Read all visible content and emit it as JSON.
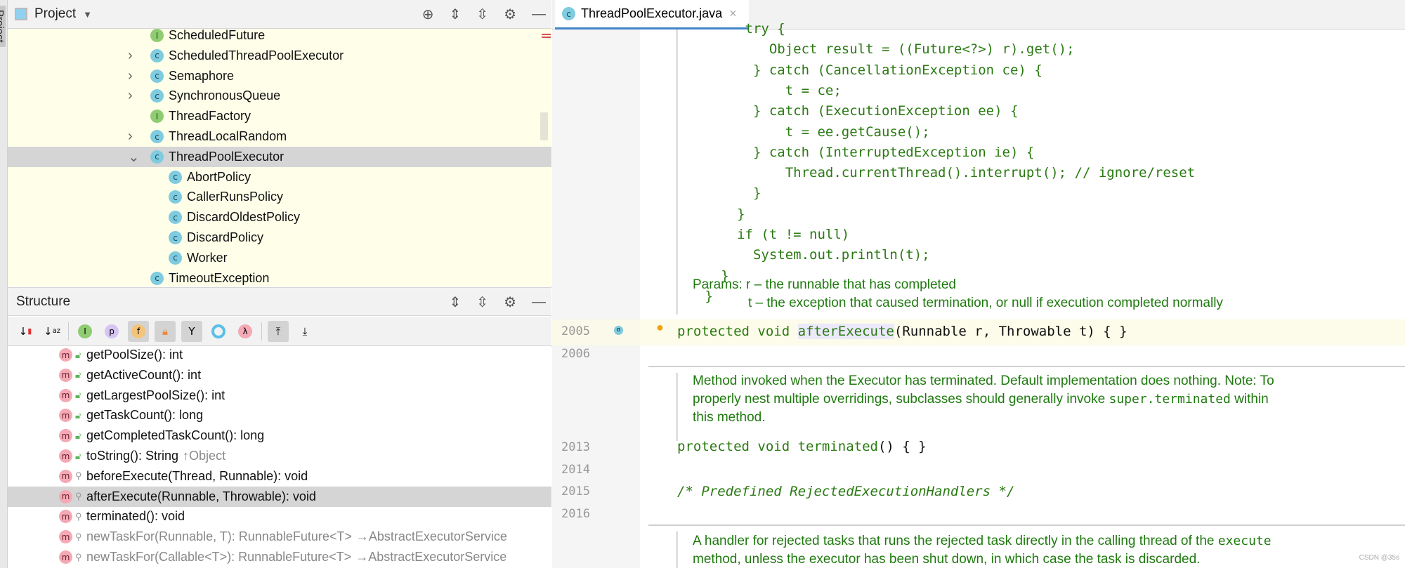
{
  "side_strip": {
    "label": "Project"
  },
  "project_panel": {
    "title": "Project",
    "tools": [
      "locate-icon",
      "expand-all-icon",
      "collapse-all-icon",
      "gear-icon",
      "minimize-icon"
    ],
    "items": [
      {
        "label": "ScheduledFuture",
        "kind": "I",
        "expandable": false,
        "level": 0
      },
      {
        "label": "ScheduledThreadPoolExecutor",
        "kind": "C",
        "expandable": true,
        "level": 0
      },
      {
        "label": "Semaphore",
        "kind": "C",
        "expandable": true,
        "level": 0
      },
      {
        "label": "SynchronousQueue",
        "kind": "C",
        "expandable": true,
        "level": 0
      },
      {
        "label": "ThreadFactory",
        "kind": "I",
        "expandable": false,
        "level": 0
      },
      {
        "label": "ThreadLocalRandom",
        "kind": "C",
        "expandable": true,
        "level": 0
      },
      {
        "label": "ThreadPoolExecutor",
        "kind": "C",
        "expandable": true,
        "expanded": true,
        "selected": true,
        "level": 0
      },
      {
        "label": "AbortPolicy",
        "kind": "C",
        "level": 1
      },
      {
        "label": "CallerRunsPolicy",
        "kind": "C",
        "level": 1
      },
      {
        "label": "DiscardOldestPolicy",
        "kind": "C",
        "level": 1
      },
      {
        "label": "DiscardPolicy",
        "kind": "C",
        "level": 1
      },
      {
        "label": "Worker",
        "kind": "C",
        "level": 1
      },
      {
        "label": "TimeoutException",
        "kind": "C",
        "expandable": false,
        "level": 0
      }
    ]
  },
  "structure_panel": {
    "title": "Structure",
    "toolbar": [
      "sort-by-visibility",
      "sort-alphabetically",
      "show-inherited",
      "show-properties",
      "show-fields",
      "show-non-public",
      "show-anonymous",
      "show-lambdas",
      "show-lambda",
      "autoscroll-to-source",
      "autoscroll-from-source"
    ],
    "items": [
      {
        "label": "getPoolSize(): int",
        "access": "public"
      },
      {
        "label": "getActiveCount(): int",
        "access": "public"
      },
      {
        "label": "getLargestPoolSize(): int",
        "access": "public"
      },
      {
        "label": "getTaskCount(): long",
        "access": "public"
      },
      {
        "label": "getCompletedTaskCount(): long",
        "access": "public"
      },
      {
        "label": "toString(): String",
        "suffix": "↑Object",
        "access": "public"
      },
      {
        "label": "beforeExecute(Thread, Runnable): void",
        "access": "protected"
      },
      {
        "label": "afterExecute(Runnable, Throwable): void",
        "access": "protected",
        "selected": true
      },
      {
        "label": "terminated(): void",
        "access": "protected"
      },
      {
        "label": "newTaskFor(Runnable, T): RunnableFuture<T>",
        "suffix": "→AbstractExecutorService",
        "access": "protected",
        "inherited": true
      },
      {
        "label": "newTaskFor(Callable<T>): RunnableFuture<T>",
        "suffix": "→AbstractExecutorService",
        "access": "protected",
        "inherited": true
      }
    ]
  },
  "editor": {
    "tab": {
      "label": "ThreadPoolExecutor.java",
      "close": "×"
    },
    "doc_code": [
      "        try {",
      "           Object result = ((Future<?>) r).get();",
      "         } catch (CancellationException ce) {",
      "             t = ce;",
      "         } catch (ExecutionException ee) {",
      "             t = ee.getCause();",
      "         } catch (InterruptedException ie) {",
      "             Thread.currentThread().interrupt(); // ignore/reset",
      "         }",
      "       }",
      "       if (t != null)",
      "         System.out.println(t);",
      "     }",
      "   }"
    ],
    "params": {
      "label": "Params:",
      "r": "r – the runnable that has completed",
      "t": "t – the exception that caused termination, or null if execution completed normally"
    },
    "line_2005": {
      "number": "2005",
      "kw": "protected void ",
      "name": "afterExecute",
      "rest": "(Runnable r, Throwable t) { }"
    },
    "line_2006": "2006",
    "doc_terminated": [
      "Method invoked when the Executor has terminated. Default implementation does nothing. Note: To",
      "properly nest multiple overridings, subclasses should generally invoke ",
      "super.terminated",
      " within",
      "this method."
    ],
    "line_2013": {
      "number": "2013",
      "kw": "protected void ",
      "name": "terminated",
      "rest": "() { }"
    },
    "line_2014": "2014",
    "line_2015": {
      "number": "2015",
      "comment": "/* Predefined RejectedExecutionHandlers */"
    },
    "line_2016": "2016",
    "doc_handler": [
      "A handler for rejected tasks that runs the rejected task directly in the calling thread of the ",
      "execute",
      "method, unless the executor has been shut down, in which case the task is discarded."
    ]
  },
  "watermark": "CSDN @35s",
  "colors": {
    "tree_bg": "#fefee9",
    "selection": "#d5d5d5",
    "doc_green": "#1f7a0f",
    "tab_underline": "#4083c9"
  }
}
